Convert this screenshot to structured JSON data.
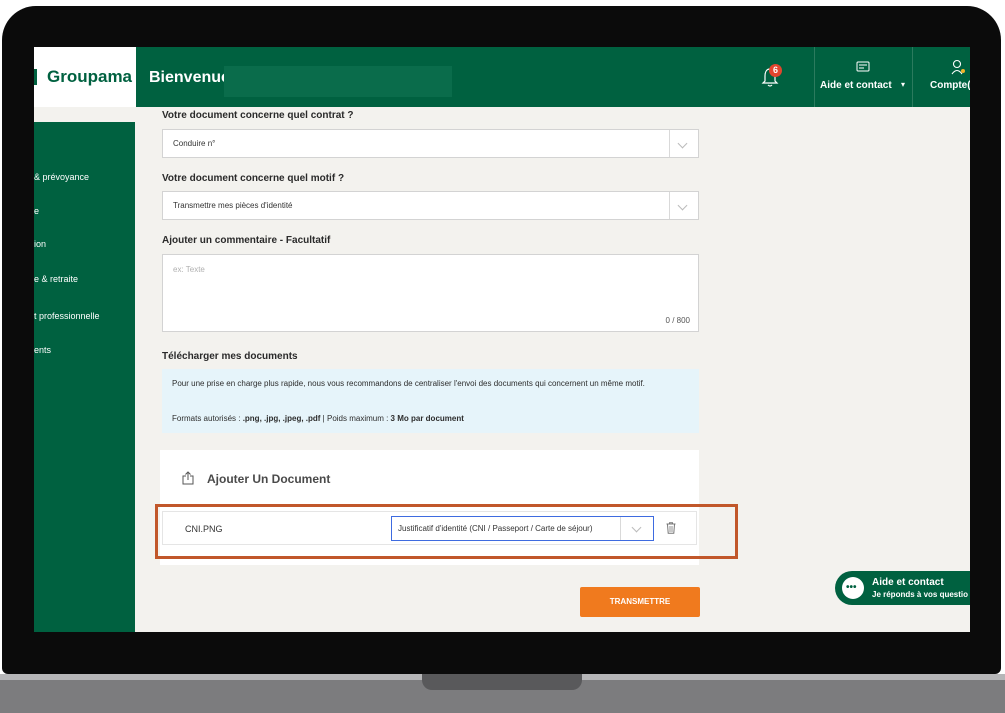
{
  "header": {
    "logo": "Groupama",
    "welcome": "Bienvenue",
    "notification_count": "6",
    "aide_label": "Aide et contact",
    "compte_label": "Compte("
  },
  "sidebar": {
    "items": [
      {
        "label": "& prévoyance"
      },
      {
        "label": "e"
      },
      {
        "label": "ion"
      },
      {
        "label": "e & retraite"
      },
      {
        "label": "t professionnelle"
      },
      {
        "label": "ents"
      }
    ]
  },
  "form": {
    "contract_label": "Votre document concerne quel contrat ?",
    "contract_value": "Conduire n°",
    "motif_label": "Votre document concerne quel motif ?",
    "motif_value": "Transmettre mes pièces d'identité",
    "comment_label": "Ajouter un commentaire - Facultatif",
    "comment_placeholder": "ex: Texte",
    "comment_count": "0 / 800",
    "download_label": "Télécharger mes documents",
    "info_text": "Pour une prise en charge plus rapide, nous vous recommandons de centraliser l'envoi des documents qui concernent un même motif.",
    "formats_prefix": "Formats autorisés : ",
    "formats_value": ".png, .jpg, .jpeg, .pdf",
    "formats_middle": " | Poids maximum : ",
    "formats_max": "3 Mo par document",
    "add_document_label": "Ajouter Un Document",
    "file": {
      "name": "CNI.PNG",
      "type": "Justificatif d'identité (CNI / Passeport / Carte de séjour)"
    },
    "submit_label": "TRANSMETTRE"
  },
  "chat": {
    "title": "Aide et contact",
    "subtitle": "Je réponds à vos questio"
  },
  "colors": {
    "brand_green": "#006140",
    "accent_orange": "#f07a1e",
    "highlight_border": "#c1572a",
    "info_bg": "#e6f4fa"
  }
}
